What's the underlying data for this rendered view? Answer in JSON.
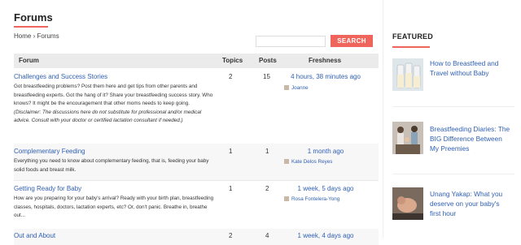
{
  "page": {
    "title": "Forums"
  },
  "breadcrumb": {
    "home": "Home",
    "separator": "›",
    "current": "Forums"
  },
  "search": {
    "placeholder": "",
    "button_label": "SEARCH"
  },
  "table": {
    "columns": [
      "Forum",
      "Topics",
      "Posts",
      "Freshness"
    ],
    "rows": [
      {
        "title": "Challenges and Success Stories",
        "desc_plain": "Got breastfeeding problems? Post them here and get tips from other parents and breastfeeding experts. Got the hang of it? Share your breastfeeding success story. Who knows? It might be the encouragement that other moms needs to keep going.",
        "desc_italic": "(Disclaimer: The discussions here do not substitute for professional and/or medical advice. Consult with your doctor or certified lactation consultant if needed.)",
        "topics": "2",
        "posts": "15",
        "freshness": "4 hours, 38 minutes ago",
        "user": "Joanne"
      },
      {
        "title": "Complementary Feeding",
        "desc_plain": "Everything you need to know about complementary feeding, that is, feeding your baby solid foods and breast milk.",
        "desc_italic": "",
        "topics": "1",
        "posts": "1",
        "freshness": "1 month ago",
        "user": "Kate Delos Reyes"
      },
      {
        "title": "Getting Ready for Baby",
        "desc_plain": "How are you preparing for your baby's arrival? Ready with your birth plan, breastfeeding classes, hospitals, doctors, lactation experts, etc? Or, don't panic. Breathe in, breathe out...",
        "desc_italic": "",
        "topics": "1",
        "posts": "2",
        "freshness": "1 week, 5 days ago",
        "user": "Rosa Fontelera-Yong"
      },
      {
        "title": "Out and About",
        "desc_plain": "",
        "desc_italic": "",
        "topics": "2",
        "posts": "4",
        "freshness": "1 week, 4 days ago",
        "user": ""
      }
    ]
  },
  "sidebar": {
    "featured_title": "FEATURED",
    "items": [
      {
        "title": "How to Breastfeed and Travel without Baby",
        "image": "bottles-photo"
      },
      {
        "title": "Breastfeeding Diaries: The BIG Difference Between My Preemies",
        "image": "family-photo"
      },
      {
        "title": "Unang Yakap: What you deserve on your baby's first hour",
        "image": "newborn-photo"
      }
    ]
  },
  "colors": {
    "accent": "#f0655b",
    "link": "#2f5fb3",
    "header_bg": "#ebebeb"
  }
}
